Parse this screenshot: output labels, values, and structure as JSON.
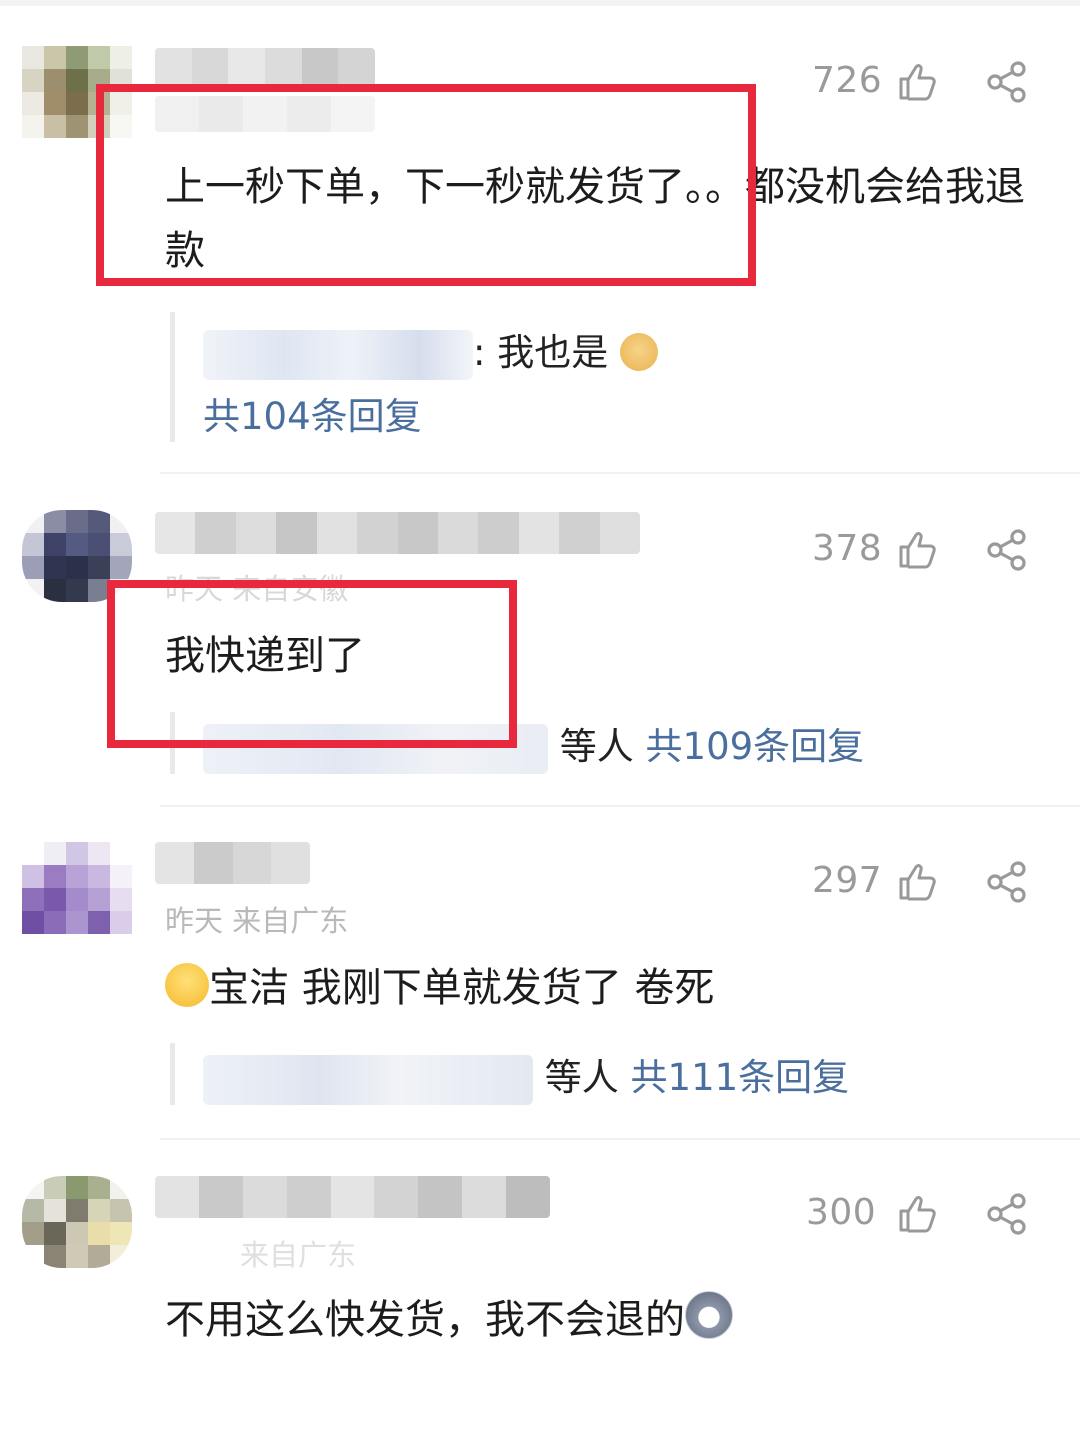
{
  "comments": [
    {
      "likes": "726",
      "text": "上一秒下单，下一秒就发货了。。都没机会给我退款",
      "reply_preview_text": "我也是",
      "reply_emoji": "doge-crying-icon",
      "reply_count_label": "共104条回复",
      "highlighted": true
    },
    {
      "likes": "378",
      "meta": "昨天 来自安徽",
      "text": "我快递到了",
      "reply_others_label": "等人",
      "reply_count_label": "共109条回复",
      "highlighted": true
    },
    {
      "likes": "297",
      "meta": "昨天 来自广东",
      "text": "宝洁 我刚下单就发货了 卷死",
      "text_emoji": "sweat-face-icon",
      "reply_others_label": "等人",
      "reply_count_label": "共111条回复",
      "highlighted": false
    },
    {
      "likes": "300",
      "meta": "来自广东",
      "text": "不用这么快发货，我不会退的",
      "text_emoji": "husky-dog-icon",
      "highlighted": false
    }
  ],
  "colors": {
    "highlight_box": "#e8283c",
    "reply_link": "#4a6f9e",
    "like_count": "#9a9a9a"
  }
}
